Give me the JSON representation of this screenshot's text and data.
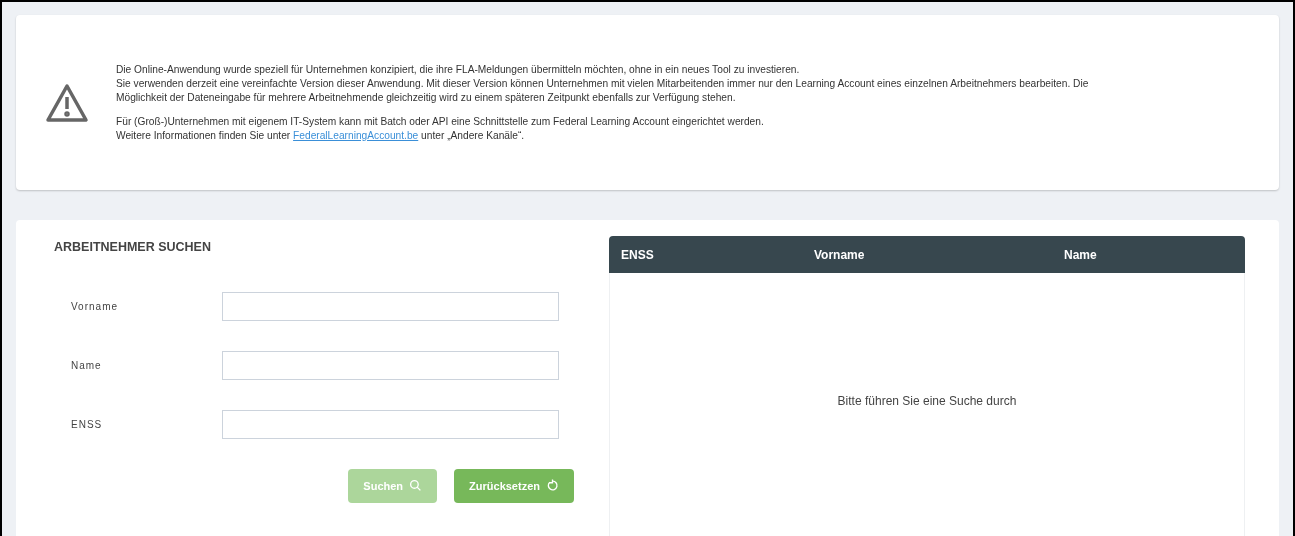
{
  "notice": {
    "lines": [
      "Die Online-Anwendung wurde speziell für Unternehmen konzipiert, die ihre FLA-Meldungen übermitteln möchten, ohne in ein neues Tool zu investieren.",
      "Sie verwenden derzeit eine vereinfachte Version dieser Anwendung. Mit dieser Version können Unternehmen mit vielen Mitarbeitenden immer nur den Learning Account eines einzelnen Arbeitnehmers bearbeiten. Die",
      "Möglichkeit der Dateneingabe für mehrere Arbeitnehmende gleichzeitig wird zu einem späteren Zeitpunkt ebenfalls zur Verfügung stehen."
    ],
    "line2": "Für (Groß-)Unternehmen mit eigenem IT-System kann mit Batch oder API eine Schnittstelle zum Federal Learning Account eingerichtet werden.",
    "info": {
      "prefix": "Weitere Informationen finden Sie unter",
      "link": "FederalLearningAccount.be",
      "suffix": "unter „Andere Kanäle“."
    }
  },
  "search": {
    "title": "ARBEITNEHMER SUCHEN",
    "fields": [
      {
        "label": "Vorname"
      },
      {
        "label": "Name"
      },
      {
        "label": "ENSS"
      }
    ],
    "buttons": [
      {
        "label": "Suchen",
        "kind": "search",
        "disabled": true
      },
      {
        "label": "Zurücksetzen",
        "kind": "reset",
        "disabled": false
      }
    ]
  },
  "results": {
    "columns": [
      "ENSS",
      "Vorname",
      "Name"
    ],
    "empty_message": "Bitte führen Sie eine Suche durch"
  }
}
